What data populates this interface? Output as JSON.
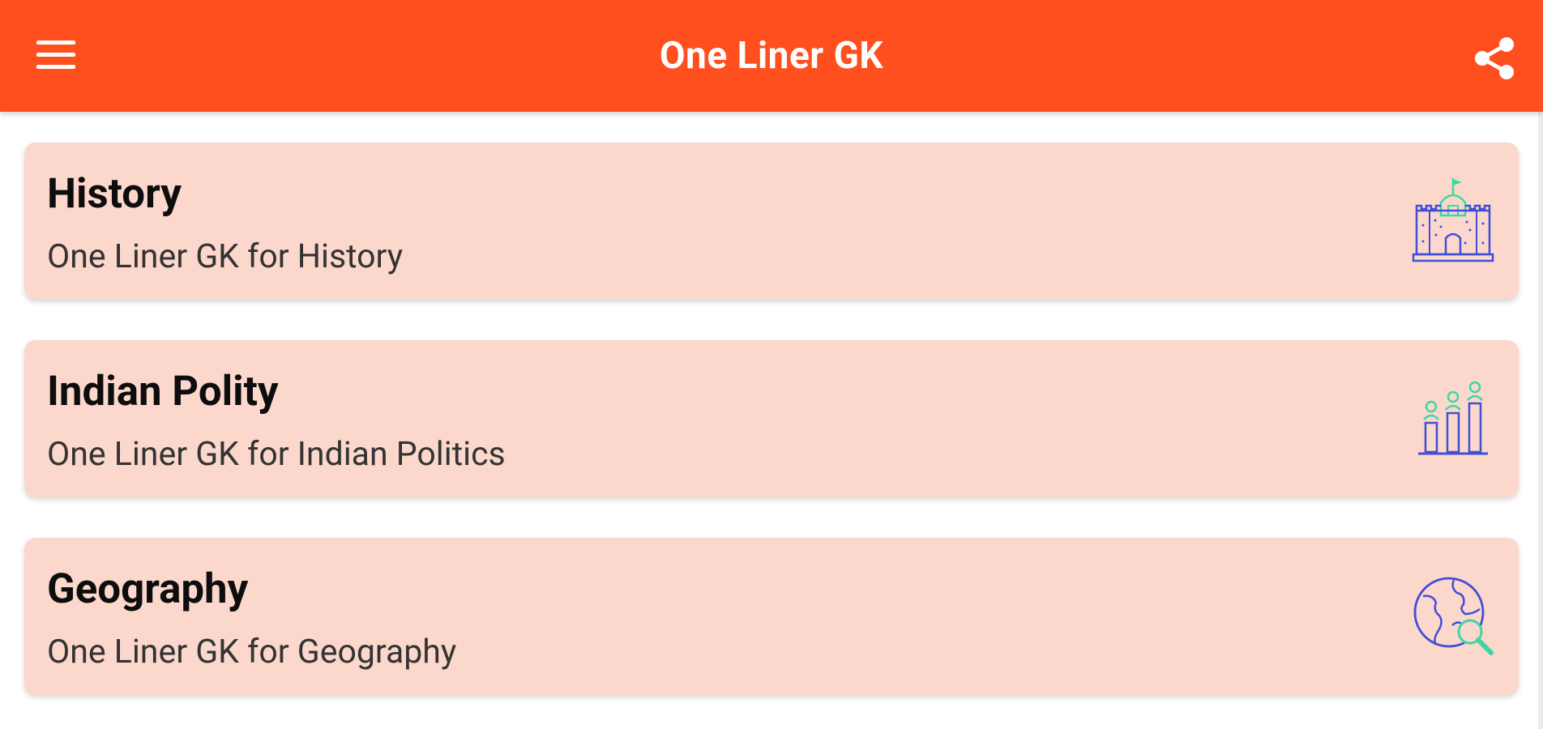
{
  "app_bar": {
    "title": "One Liner GK",
    "menu_icon": "hamburger-menu-icon",
    "share_icon": "share-icon",
    "color": "#ff4f1f"
  },
  "categories": [
    {
      "title": "History",
      "subtitle": "One Liner GK for History",
      "icon": "castle-icon"
    },
    {
      "title": "Indian Polity",
      "subtitle": "One Liner GK for Indian Politics",
      "icon": "politics-chart-icon"
    },
    {
      "title": "Geography",
      "subtitle": "One Liner GK for Geography",
      "icon": "globe-search-icon"
    }
  ],
  "colors": {
    "card_background": "#fcd8cc",
    "icon_blue": "#3f4fd8",
    "icon_green": "#3fd6a5"
  }
}
